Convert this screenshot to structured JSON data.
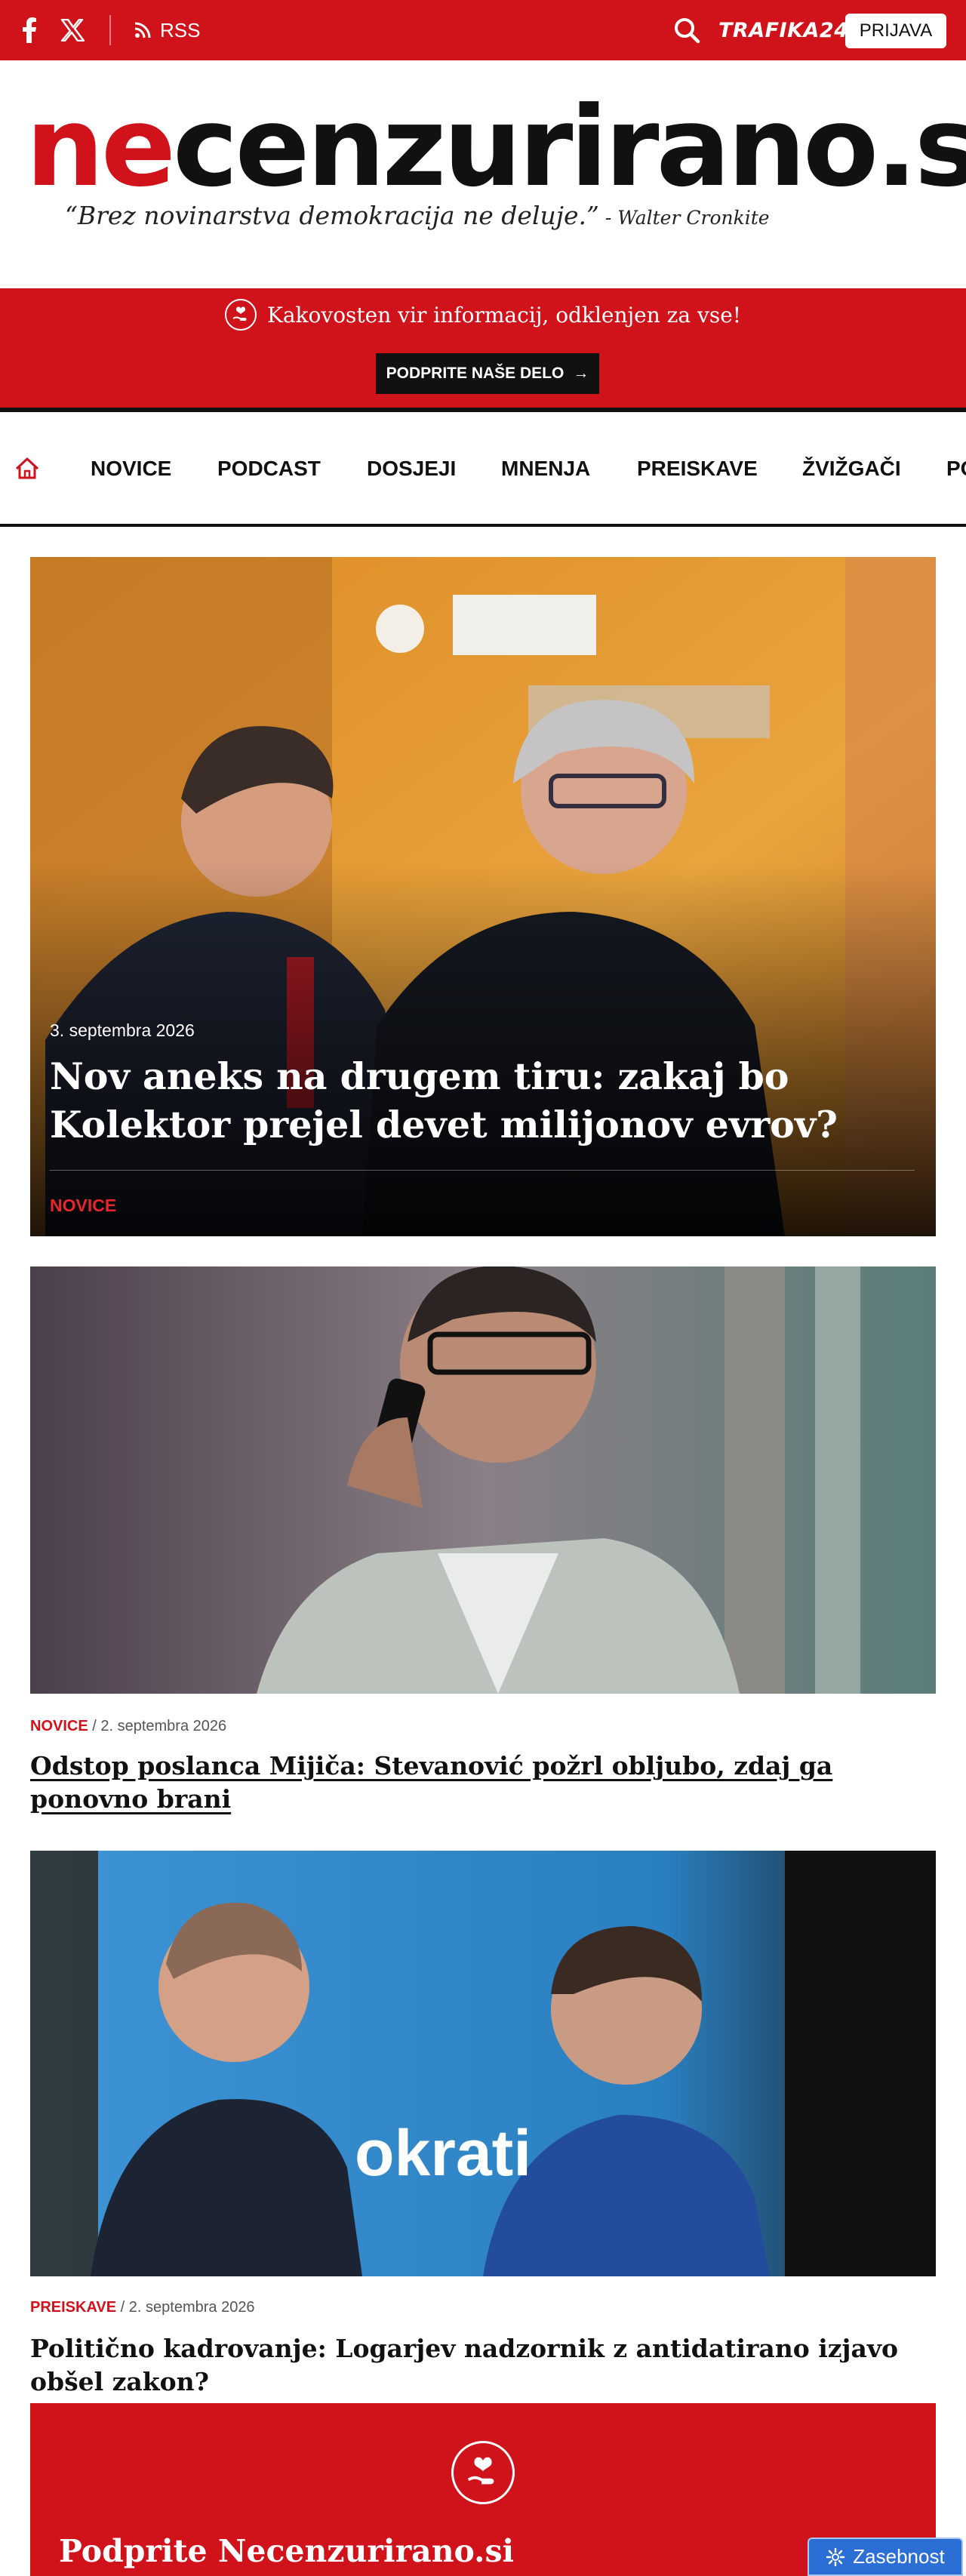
{
  "topbar": {
    "rss_label": "RSS",
    "trafika_label": "TRAFIKA24",
    "login_label": "PRIJAVA",
    "icons": [
      "facebook-icon",
      "x-twitter-icon",
      "rss-icon",
      "search-icon"
    ]
  },
  "brand": {
    "logo_red": "ne",
    "logo_black": "cenzurirano.si",
    "tagline": "“Brez novinarstva demokracija ne deluje.”",
    "tagline_author": " - Walter Cronkite"
  },
  "support": {
    "text": "Kakovosten vir informacij, odklenjen za vse!",
    "button_label": "PODPRITE NAŠE DELO",
    "button_arrow": "→"
  },
  "nav": {
    "items": [
      {
        "label": "NOVICE"
      },
      {
        "label": "PODCAST"
      },
      {
        "label": "DOSJEJI"
      },
      {
        "label": "MNENJA"
      },
      {
        "label": "PREISKAVE"
      },
      {
        "label": "ŽVIŽGAČI"
      },
      {
        "label": "PO"
      }
    ]
  },
  "articles": [
    {
      "date": "3. septembra 2026",
      "title": "Nov aneks na drugem tiru: zakaj bo Kolektor prejel devet milijonov evrov?",
      "category": "NOVICE"
    },
    {
      "category": "NOVICE",
      "separator": " / ",
      "date": "2. septembra 2026",
      "title": "Odstop poslanca Mijiča: Stevanović požrl obljubo, zdaj ga ponovno brani"
    },
    {
      "category": "PREISKAVE",
      "separator": " / ",
      "date": "2. septembra 2026",
      "title": "Politično kadrovanje: Logarjev nadzornik z antidatirano izjavo obšel zakon?",
      "image_text": "okrati"
    }
  ],
  "donate": {
    "title": "Podprite Necenzurirano.si"
  },
  "privacy": {
    "label": "Zasebnost"
  },
  "colors": {
    "brand_red": "#d0121b",
    "dark": "#111111",
    "privacy_blue": "#2b6fd4"
  }
}
